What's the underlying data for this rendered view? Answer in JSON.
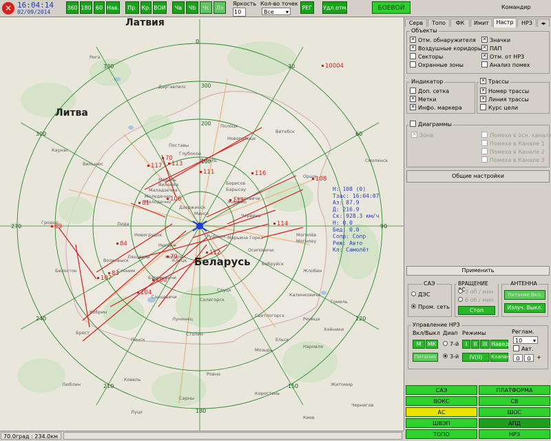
{
  "topbar": {
    "close": "✕",
    "time": "16:04:14",
    "date": "02/09/2014",
    "buttons": [
      "360",
      "180",
      "60",
      "Нав.",
      "Пр.",
      "Кр.",
      "ВОИ",
      "Чв",
      "Чb",
      "Чс",
      "Лэ"
    ],
    "brightness_label": "Яркость",
    "brightness_value": "10",
    "points_label": "Кол-во точек",
    "points_value": "Все",
    "reg": "РЕГ",
    "del_marks": "Удл.отм.",
    "mode": "БОЕВОЙ",
    "user": "Командир"
  },
  "map": {
    "countries": [
      "Латвия",
      "Литва",
      "Беларусь"
    ],
    "range_labels": [
      "0",
      "30",
      "60",
      "90",
      "120",
      "150",
      "180",
      "210",
      "240",
      "270",
      "300",
      "330"
    ],
    "ring_labels": [
      "100",
      "200",
      "300"
    ],
    "targets": [
      {
        "id": "10004"
      },
      {
        "id": "117"
      },
      {
        "id": "113"
      },
      {
        "id": "70"
      },
      {
        "id": "111"
      },
      {
        "id": "116"
      },
      {
        "id": "108"
      },
      {
        "id": "115"
      },
      {
        "id": "81"
      },
      {
        "id": "106"
      },
      {
        "id": "114"
      },
      {
        "id": "89"
      },
      {
        "id": "84"
      },
      {
        "id": "112"
      },
      {
        "id": "79"
      },
      {
        "id": "83"
      },
      {
        "id": "107"
      },
      {
        "id": "100"
      },
      {
        "id": "104"
      }
    ],
    "info": [
      "Н: 108 (0)",
      "Тзас: 16:04:07",
      "Аз: 87.9",
      "Д: 216.9",
      "Ск: 928.3 км/ч",
      "H: 0.0",
      "Бед: 0.0",
      "Сопр: Сопр",
      "Реж: Авто",
      "Кл: Самолёт"
    ],
    "cities": [
      "Минск",
      "Моледечно",
      "Борисов",
      "Барысау",
      "Маладзечна",
      "Молодечно",
      "Новополоцк",
      "Витебск",
      "Смоленск",
      "Могилёв",
      "Могилеу",
      "Орша",
      "Гродно",
      "Лида",
      "Барановичи",
      "Слуцк",
      "Пинск",
      "Брест",
      "Мозырь",
      "Речица",
      "Гомель",
      "Светлогорск",
      "Бобруйск",
      "Жлобин",
      "Солигорск",
      "Вильнюс",
      "Каунас",
      "Даугавпилс",
      "Рига",
      "Киев",
      "Чернигов",
      "Белосток",
      "Люблин",
      "Ковель",
      "Луцк",
      "Ровно",
      "Житомир",
      "Сарны",
      "Коростень",
      "Кобрин",
      "Волковыск",
      "Слоним",
      "Новогрудок",
      "Поставы",
      "Глубокое",
      "Лепель",
      "Полоцк",
      "Осиповичи",
      "Мядель",
      "Вилейка",
      "Дзержинск",
      "Марьина Горка",
      "Руденск",
      "Червень",
      "Смолевичи",
      "Жодино",
      "Копыль",
      "Несвиж",
      "Клецк",
      "Ляховичи",
      "Ганцевичи",
      "Лунинец",
      "Столин",
      "Калинковичи",
      "Хойники",
      "Наровля",
      "Ельск"
    ],
    "status_left": "70.0град : 234.0км",
    "status_right": ""
  },
  "panel": {
    "tabs": [
      "Серв",
      "Топо",
      "ФК",
      "Имит",
      "Настр",
      "НРЗ"
    ],
    "active_tab": "Настр",
    "objects_title": "Объекты",
    "objects": [
      {
        "label": "Отм. обнаружителя",
        "checked": true
      },
      {
        "label": "Значки",
        "checked": true
      },
      {
        "label": "Воздушные коридоры",
        "checked": true
      },
      {
        "label": "ПАП",
        "checked": true
      },
      {
        "label": "Секторы",
        "checked": false
      },
      {
        "label": "Отм. от НРЗ",
        "checked": true
      },
      {
        "label": "Охранные зоны",
        "checked": false
      },
      {
        "label": "Анализ помех",
        "checked": false
      }
    ],
    "indicator_title": "Индикатор",
    "indicator": [
      {
        "label": "Доп. сетка",
        "checked": false
      },
      {
        "label": "Метки",
        "checked": true
      },
      {
        "label": "Инфо. маркера",
        "checked": true
      }
    ],
    "tracks_title": "Трассы",
    "tracks": [
      {
        "label": "Номер трассы",
        "checked": true
      },
      {
        "label": "Линия трассы",
        "checked": true
      },
      {
        "label": "Курс цели",
        "checked": false
      }
    ],
    "diagrams_title": "Диаграммы",
    "diagrams_left": [
      {
        "label": "Зона",
        "checked": true
      }
    ],
    "diagrams_right": [
      {
        "label": "Помеха в осн. канале"
      },
      {
        "label": "Помеха в Канале 1"
      },
      {
        "label": "Помеха в Канале 2"
      },
      {
        "label": "Помеха в Канале 3"
      }
    ],
    "general_settings": "Общие настройки",
    "apply": "Применить",
    "sae_title": "САЭ",
    "sae_opts": [
      "ДЭС",
      "Пром. сеть"
    ],
    "rotation_title": "ВРАЩЕНИЕ АС",
    "rotation_opts": [
      "3 об / мин",
      "6 об / мин"
    ],
    "stop": "Стоп",
    "antenna_title": "АНТЕННА",
    "antenna_btns": [
      "Питание Вкл.",
      "Излуч. Выкл."
    ],
    "nrz_title": "Управление НРЗ",
    "onoff_label": "Вкл/Выкл",
    "band_label": "Диап",
    "modes_label": "Режимы",
    "regl_label": "Реглам.",
    "mk": [
      "М",
      "МК"
    ],
    "power": "Питание",
    "band": [
      "7-й",
      "3-й"
    ],
    "modes": [
      "I",
      "II",
      "III",
      "Навед",
      "IV(II)",
      "Клапан"
    ],
    "regl_value": "10",
    "avt": "Авт.",
    "nums": [
      "0",
      "0"
    ],
    "bottom": [
      {
        "label": "САЭ",
        "color": "g"
      },
      {
        "label": "ПЛАТФОРМА",
        "color": "g"
      },
      {
        "label": "ВОКС",
        "color": "g"
      },
      {
        "label": "СВ",
        "color": "g"
      },
      {
        "label": "АС",
        "color": "y"
      },
      {
        "label": "ШОС",
        "color": "g"
      },
      {
        "label": "ШВЭП",
        "color": "g"
      },
      {
        "label": "АПД",
        "color": "dk"
      },
      {
        "label": "ТОПО",
        "color": "g"
      },
      {
        "label": "НРЗ",
        "color": "g"
      }
    ]
  }
}
